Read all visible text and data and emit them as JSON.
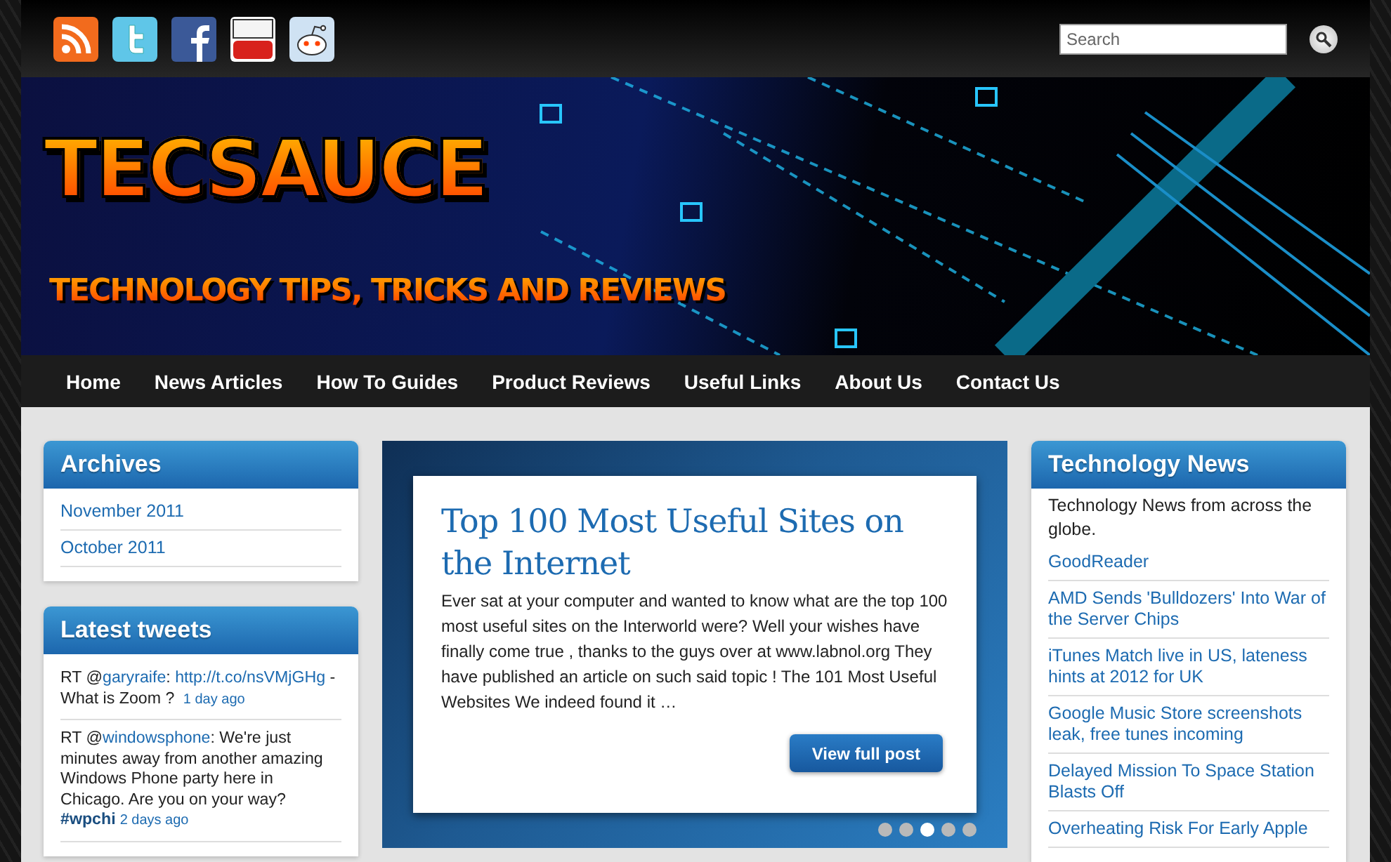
{
  "top_bar": {
    "social_icons": [
      {
        "kind": "rss"
      },
      {
        "kind": "twitter"
      },
      {
        "kind": "facebook"
      },
      {
        "kind": "youtube"
      },
      {
        "kind": "reddit"
      }
    ],
    "search": {
      "placeholder": "Search"
    }
  },
  "banner": {
    "title": "TECSAUCE",
    "tagline": "TECHNOLOGY TIPS, TRICKS AND REVIEWS"
  },
  "nav": {
    "items": [
      "Home",
      "News Articles",
      "How To Guides",
      "Product Reviews",
      "Useful Links",
      "About Us",
      "Contact Us"
    ]
  },
  "archives": {
    "title": "Archives",
    "items": [
      "November 2011",
      "October 2011"
    ]
  },
  "tweets": {
    "title": "Latest tweets",
    "items": [
      {
        "parts": [
          {
            "kind": "text",
            "text": "RT @"
          },
          {
            "kind": "link",
            "text": "garyraife"
          },
          {
            "kind": "text",
            "text": ": "
          },
          {
            "kind": "link",
            "text": "http://t.co/nsVMjGHg"
          },
          {
            "kind": "text",
            "text": " - What is Zoom ? "
          }
        ],
        "time": "1 day ago"
      },
      {
        "parts": [
          {
            "kind": "text",
            "text": "RT @"
          },
          {
            "kind": "link",
            "text": "windowsphone"
          },
          {
            "kind": "text",
            "text": ": We're just minutes away from another amazing Windows Phone party here in Chicago. Are you on your way? "
          },
          {
            "kind": "tag",
            "text": "#wpchi"
          }
        ],
        "time": "2 days ago"
      }
    ]
  },
  "featured": {
    "title": "Top 100 Most Useful Sites on the Internet",
    "excerpt": "Ever sat at your computer and wanted to know what are the top 100 most useful sites on the Interworld were? Well your wishes have finally come true , thanks to the guys over at www.labnol.org They have published an article on such said topic ! The 101 Most Useful Websites We indeed found it …",
    "button": "View full post",
    "dots": [
      {
        "selected": false
      },
      {
        "selected": false
      },
      {
        "selected": true
      },
      {
        "selected": false
      },
      {
        "selected": false
      }
    ]
  },
  "tech_news": {
    "title": "Technology News",
    "intro": "Technology News from across the globe.",
    "items": [
      "GoodReader",
      "AMD Sends 'Bulldozers' Into War of the Server Chips",
      "iTunes Match live in US, lateness hints at 2012 for UK",
      "Google Music Store screenshots leak, free tunes incoming",
      "Delayed Mission To Space Station Blasts Off",
      "Overheating Risk For Early Apple"
    ]
  }
}
